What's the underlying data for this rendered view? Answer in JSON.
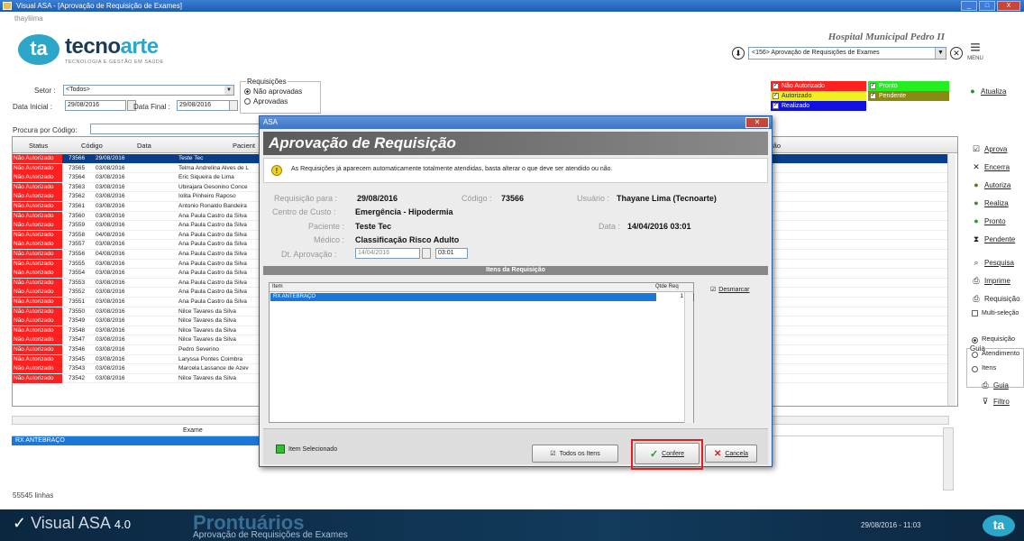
{
  "window": {
    "title": "Visual ASA - [Aprovação de Requisição de Exames]",
    "user": "thayliima",
    "controls": [
      "_",
      "□",
      "X"
    ]
  },
  "header": {
    "logo_mark": "ta",
    "brand_prefix": "tecno",
    "brand_suffix": "arte",
    "brand_tagline": "TECNOLOGIA E GESTÃO EM SAÚDE",
    "hospital": "Hospital Municipal Pedro II",
    "screen_select": "<156> Aprovação de Requisições de Exames",
    "menu_label": "MENU"
  },
  "filters": {
    "setor_label": "Setor :",
    "setor_value": "<Todos>",
    "data_inicial_label": "Data Inicial :",
    "data_inicial_value": "29/08/2016",
    "data_final_label": "Data Final :",
    "data_final_value": "29/08/2016",
    "requisicoes_label": "Requisições",
    "opt_nao_aprovadas": "Não aprovadas",
    "opt_aprovadas": "Aprovadas",
    "procura_label": "Procura por Código:"
  },
  "legend": {
    "nao_autorizado": "Não Autorizado",
    "pronto": "Pronto",
    "autorizado": "Autorizado",
    "pendente": "Pendente",
    "realizado": "Realizado",
    "colors": {
      "nao_autorizado": "#ff2020",
      "pronto": "#22ee22",
      "autorizado": "#f0f020",
      "pendente": "#8a8a10",
      "realizado": "#1010e0"
    }
  },
  "grid": {
    "columns": {
      "status": "Status",
      "codigo": "Código",
      "data": "Data",
      "paciente": "Pacient",
      "extra": "ção"
    },
    "rows": [
      {
        "status": "Não Autorizado",
        "codigo": "73566",
        "data": "29/08/2016",
        "paciente": "Teste Tec",
        "selected": true
      },
      {
        "status": "Não Autorizado",
        "codigo": "73565",
        "data": "03/08/2016",
        "paciente": "Telma Andrelina Alves de L"
      },
      {
        "status": "Não Autorizado",
        "codigo": "73564",
        "data": "03/08/2016",
        "paciente": "Eric Siqueira de Lima"
      },
      {
        "status": "Não Autorizado",
        "codigo": "73563",
        "data": "03/08/2016",
        "paciente": "Ubirajara Gesonino Conce"
      },
      {
        "status": "Não Autorizado",
        "codigo": "73562",
        "data": "03/08/2016",
        "paciente": "Iolita Pinheiro Raposo"
      },
      {
        "status": "Não Autorizado",
        "codigo": "73561",
        "data": "03/08/2016",
        "paciente": "Antonio Ronaldo Bandeira"
      },
      {
        "status": "Não Autorizado",
        "codigo": "73560",
        "data": "03/08/2016",
        "paciente": "Ana Paula Castro da Silva"
      },
      {
        "status": "Não Autorizado",
        "codigo": "73559",
        "data": "03/08/2016",
        "paciente": "Ana Paula Castro da Silva"
      },
      {
        "status": "Não Autorizado",
        "codigo": "73558",
        "data": "04/08/2016",
        "paciente": "Ana Paula Castro da Silva"
      },
      {
        "status": "Não Autorizado",
        "codigo": "73557",
        "data": "03/08/2016",
        "paciente": "Ana Paula Castro da Silva"
      },
      {
        "status": "Não Autorizado",
        "codigo": "73556",
        "data": "04/08/2016",
        "paciente": "Ana Paula Castro da Silva"
      },
      {
        "status": "Não Autorizado",
        "codigo": "73555",
        "data": "03/08/2016",
        "paciente": "Ana Paula Castro da Silva"
      },
      {
        "status": "Não Autorizado",
        "codigo": "73554",
        "data": "03/08/2016",
        "paciente": "Ana Paula Castro da Silva"
      },
      {
        "status": "Não Autorizado",
        "codigo": "73553",
        "data": "03/08/2016",
        "paciente": "Ana Paula Castro da Silva"
      },
      {
        "status": "Não Autorizado",
        "codigo": "73552",
        "data": "03/08/2016",
        "paciente": "Ana Paula Castro da Silva"
      },
      {
        "status": "Não Autorizado",
        "codigo": "73551",
        "data": "03/08/2016",
        "paciente": "Ana Paula Castro da Silva"
      },
      {
        "status": "Não Autorizado",
        "codigo": "73550",
        "data": "03/08/2016",
        "paciente": "Nilce Tavares da Silva"
      },
      {
        "status": "Não Autorizado",
        "codigo": "73549",
        "data": "03/08/2016",
        "paciente": "Nilce Tavares da Silva"
      },
      {
        "status": "Não Autorizado",
        "codigo": "73548",
        "data": "03/08/2016",
        "paciente": "Nilce Tavares da Silva"
      },
      {
        "status": "Não Autorizado",
        "codigo": "73547",
        "data": "03/08/2016",
        "paciente": "Nilce Tavares da Silva"
      },
      {
        "status": "Não Autorizado",
        "codigo": "73546",
        "data": "03/08/2016",
        "paciente": "Pedro Severino"
      },
      {
        "status": "Não Autorizado",
        "codigo": "73545",
        "data": "03/08/2016",
        "paciente": "Laryssa Pontes Coimbra"
      },
      {
        "status": "Não Autorizado",
        "codigo": "73543",
        "data": "03/08/2016",
        "paciente": "Marcela Lassance de Azev"
      },
      {
        "status": "Não Autorizado",
        "codigo": "73542",
        "data": "03/08/2016",
        "paciente": "Nilce Tavares da Silva"
      }
    ],
    "sub_header": "Exame",
    "sub_row": "RX ANTEBRAÇO",
    "row_count": "55545 linhas"
  },
  "toolbar": {
    "atualiza": "Atualiza",
    "aprova": "Aprova",
    "encerra": "Encerra",
    "autoriza": "Autoriza",
    "realiza": "Realiza",
    "pronto": "Pronto",
    "pendente": "Pendente",
    "pesquisa": "Pesquisa",
    "imprime": "Imprime",
    "requisicao": "Requisição",
    "multi_selecao": "Multi-seleção",
    "guia_group": "Guia",
    "guia_requisicao": "Requisição",
    "guia_atendimento": "Atendimento",
    "guia_itens": "Itens",
    "guia": "Guia",
    "filtro": "Filtro"
  },
  "dialog": {
    "title": "ASA",
    "heading": "Aprovação de Requisição",
    "info": "As Requisições já aparecem automaticamente totalmente atendidas, basta alterar o que deve ser atendido ou não.",
    "req_label": "Requisição para :",
    "req_value": "29/08/2016",
    "codigo_label": "Código :",
    "codigo_value": "73566",
    "usuario_label": "Usuário :",
    "usuario_value": "Thayane Lima (Tecnoarte)",
    "cc_label": "Centro de Custo :",
    "cc_value": "Emergência - Hipodermia",
    "paciente_label": "Paciente :",
    "paciente_value": "Teste Tec",
    "data_label": "Data :",
    "data_value": "14/04/2016 03:01",
    "medico_label": "Médico :",
    "medico_value": "Classificação Risco Adulto",
    "aprov_label": "Dt. Aprovação :",
    "aprov_date": "14/04/2016",
    "aprov_time": "03:01",
    "itens_section": "Itens da Requisição",
    "col_item": "Item",
    "col_qtde": "Qtde Req",
    "item_name": "RX ANTEBRAÇO",
    "item_qtde": "1",
    "desmarcar": "Desmarcar",
    "item_selecionado": "Item Selecionado",
    "todos_itens": "Todos os Itens",
    "confere": "Confere",
    "cancela": "Cancela"
  },
  "footer": {
    "brand": "Visual ASA",
    "version": "4.0",
    "module": "Prontuários",
    "module_sub": "Aprovação de Requisições de Exames",
    "clock": "29/08/2016 - 11:03",
    "logo_mark": "ta"
  }
}
